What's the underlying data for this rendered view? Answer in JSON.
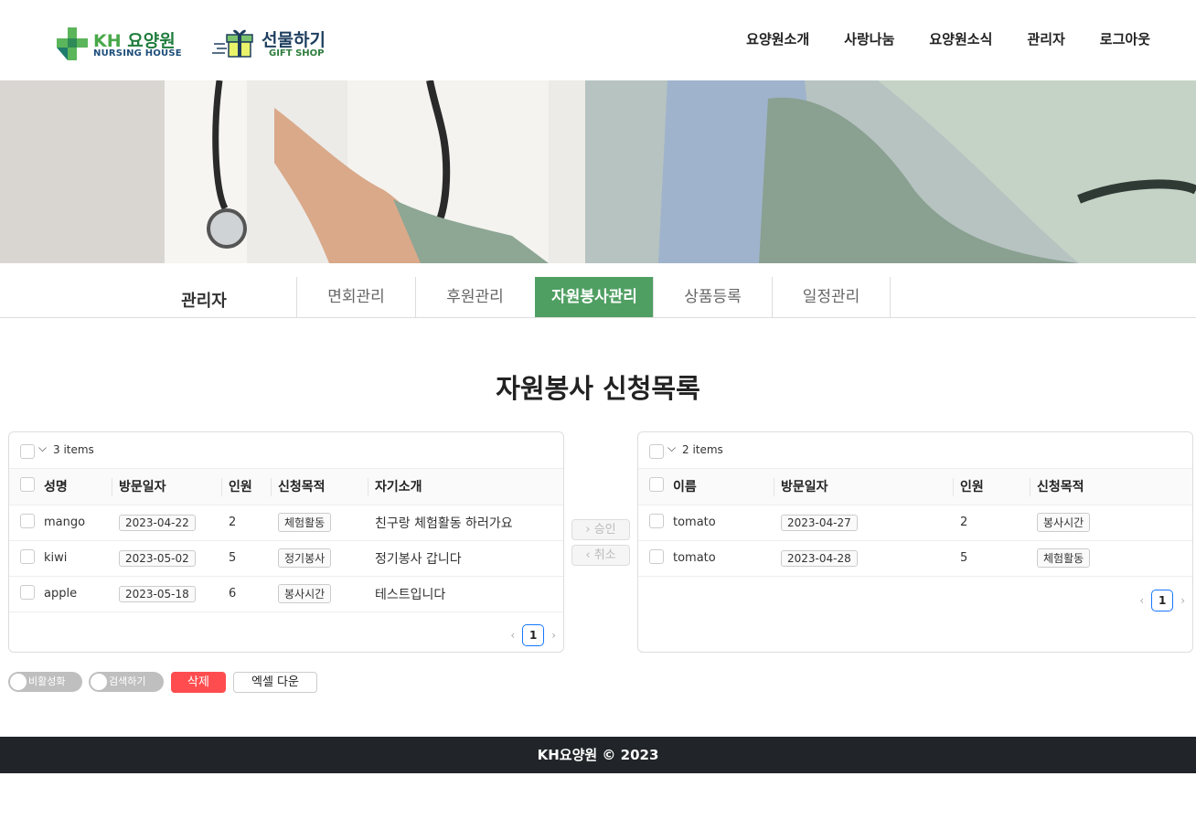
{
  "header": {
    "logo_main": {
      "kh": "KH",
      "text": "요양원",
      "sub": "NURSING HOUSE"
    },
    "logo_gift": {
      "text": "선물하기",
      "sub": "GIFT SHOP"
    },
    "nav": [
      "요양원소개",
      "사랑나눔",
      "요양원소식",
      "관리자",
      "로그아웃"
    ]
  },
  "subnav": {
    "title": "관리자",
    "tabs": [
      "면회관리",
      "후원관리",
      "자원봉사관리",
      "상품등록",
      "일정관리"
    ],
    "active_index": 2
  },
  "page_title": "자원봉사 신청목록",
  "left_panel": {
    "count_label": "3 items",
    "columns": [
      "성명",
      "방문일자",
      "인원",
      "신청목적",
      "자기소개"
    ],
    "rows": [
      {
        "name": "mango",
        "date": "2023-04-22",
        "count": "2",
        "purpose": "체험활동",
        "intro": "친구랑 체험활동 하러가요"
      },
      {
        "name": "kiwi",
        "date": "2023-05-02",
        "count": "5",
        "purpose": "정기봉사",
        "intro": "정기봉사 갑니다"
      },
      {
        "name": "apple",
        "date": "2023-05-18",
        "count": "6",
        "purpose": "봉사시간",
        "intro": "테스트입니다"
      }
    ],
    "page": "1"
  },
  "right_panel": {
    "count_label": "2 items",
    "columns": [
      "이름",
      "방문일자",
      "인원",
      "신청목적"
    ],
    "rows": [
      {
        "name": "tomato",
        "date": "2023-04-27",
        "count": "2",
        "purpose": "봉사시간"
      },
      {
        "name": "tomato",
        "date": "2023-04-28",
        "count": "5",
        "purpose": "체험활동"
      }
    ],
    "page": "1"
  },
  "transfer": {
    "approve": "승인",
    "cancel": "취소"
  },
  "controls": {
    "toggle_disable": "비활성화",
    "toggle_search": "검색하기",
    "delete": "삭제",
    "excel": "엑셀 다운"
  },
  "footer": "KH요양원 © 2023",
  "colors": {
    "accent_green": "#4f9f62",
    "danger": "#ff4d4f",
    "footer_bg": "#212529",
    "pager_border": "#1677ff"
  }
}
